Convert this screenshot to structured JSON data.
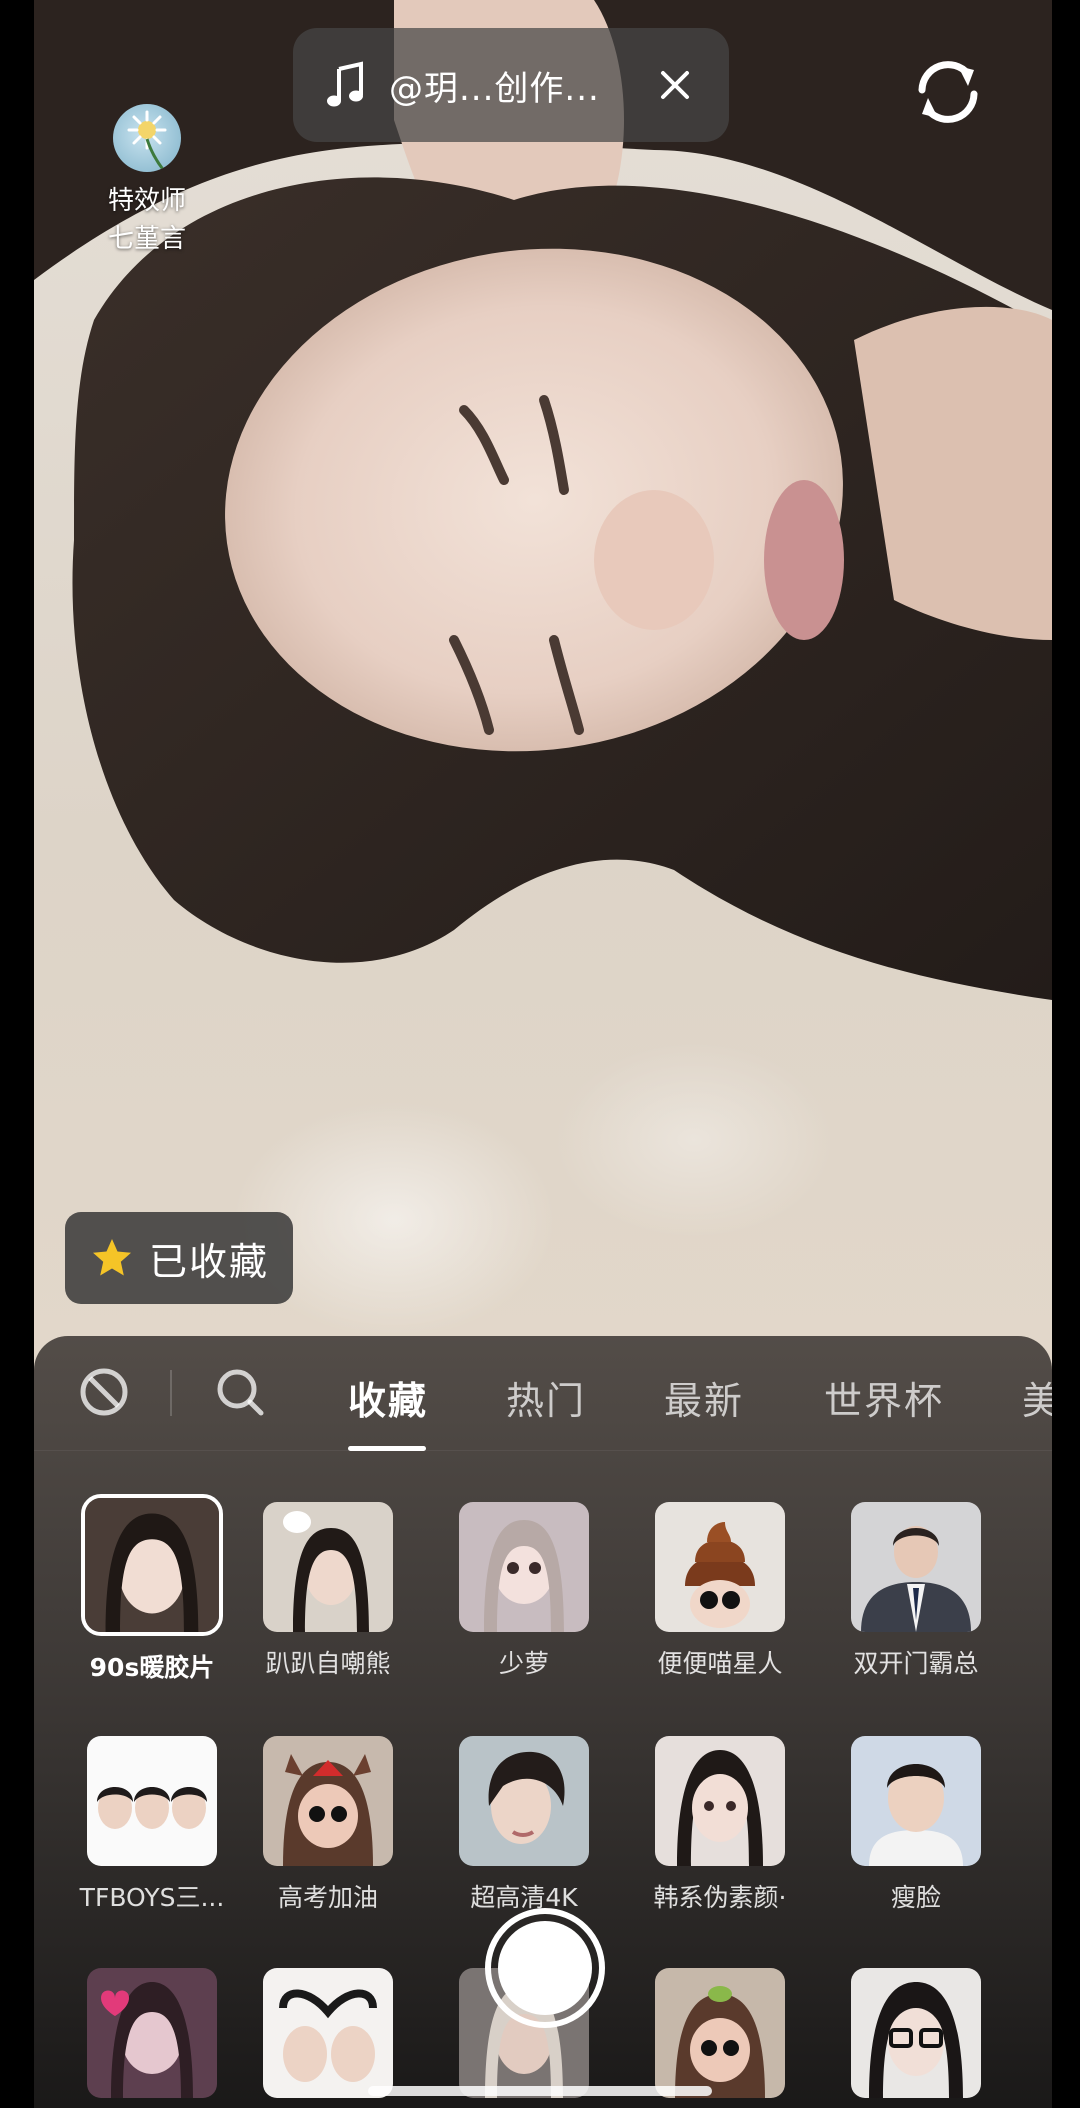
{
  "music": {
    "title": "@玥...创作..."
  },
  "creator": {
    "line1": "特效师",
    "line2": "七堇言"
  },
  "favorite_button": {
    "label": "已收藏"
  },
  "tabs": [
    {
      "label": "收藏"
    },
    {
      "label": "热门"
    },
    {
      "label": "最新"
    },
    {
      "label": "世界杯"
    },
    {
      "label": "美"
    }
  ],
  "effects": [
    {
      "label": "90s暖胶片"
    },
    {
      "label": "趴趴自嘲熊"
    },
    {
      "label": "少萝"
    },
    {
      "label": "便便喵星人"
    },
    {
      "label": "双开门霸总"
    },
    {
      "label": "TFBOYS三..."
    },
    {
      "label": "高考加油"
    },
    {
      "label": "超高清4K"
    },
    {
      "label": "韩系伪素颜·"
    },
    {
      "label": "瘦脸"
    }
  ],
  "colors": {
    "star": "#f5c427",
    "panel": "#3f3a37"
  }
}
